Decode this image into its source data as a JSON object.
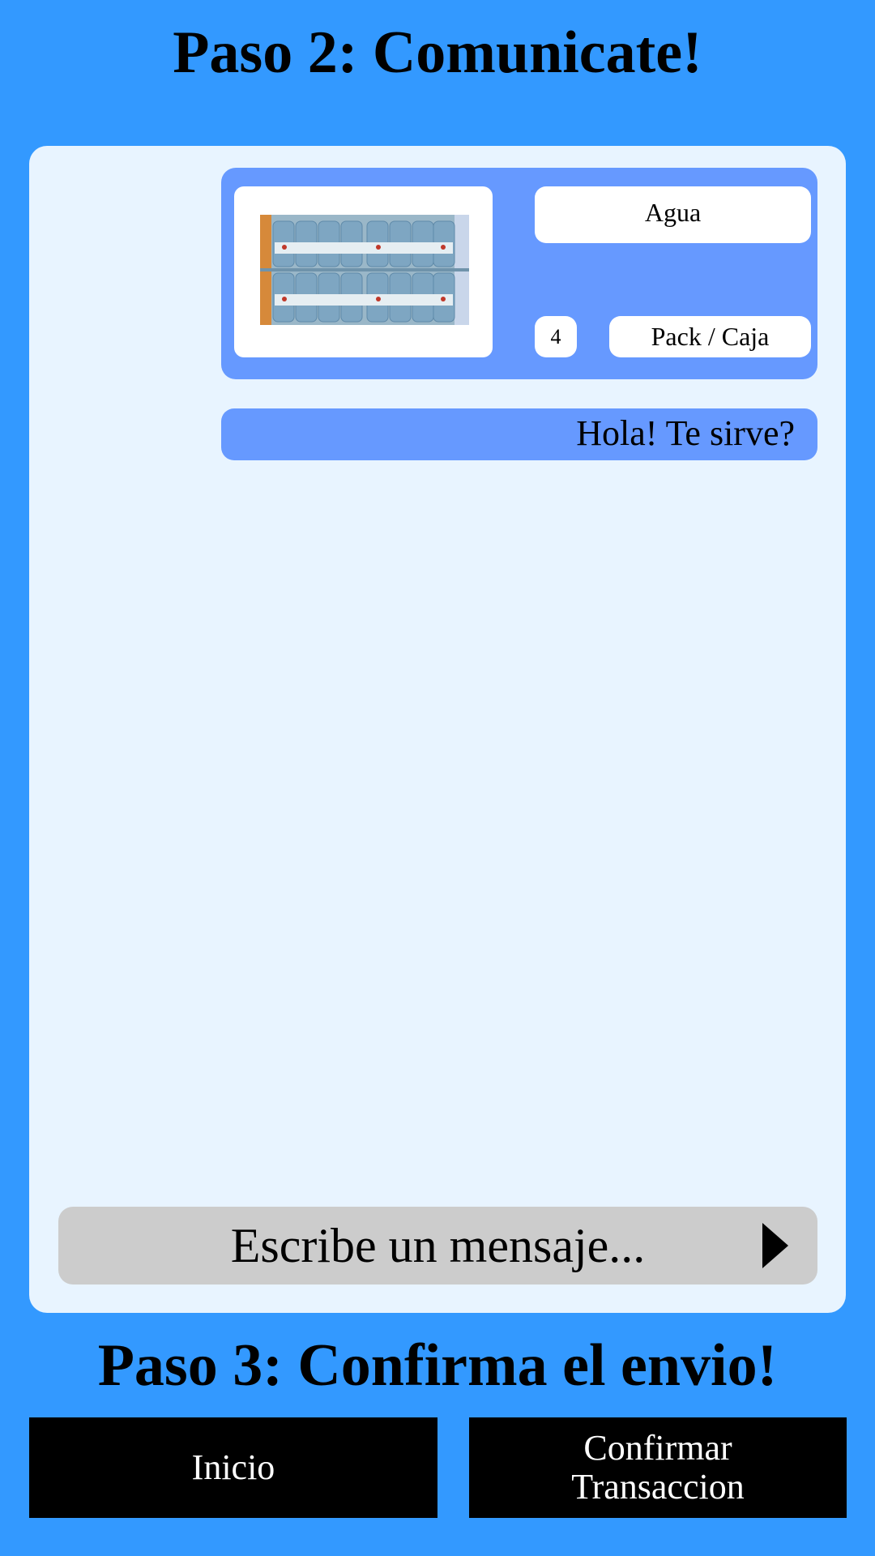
{
  "step2": {
    "title": "Paso 2: Comunicate!"
  },
  "product": {
    "name": "Agua",
    "quantity": "4",
    "unit": "Pack / Caja",
    "image_icon": "water-bottles-pack-photo"
  },
  "chat": {
    "messages": [
      {
        "text": "Hola! Te sirve?"
      }
    ]
  },
  "composer": {
    "placeholder": "Escribe un mensaje...",
    "value": "",
    "send_icon": "play-triangle-icon"
  },
  "step3": {
    "title": "Paso 3: Confirma el envio!"
  },
  "buttons": {
    "home_label": "Inicio",
    "confirm_label": "Confirmar Transaccion"
  },
  "colors": {
    "background": "#3399ff",
    "panel": "#e8f4ff",
    "card": "#6699ff",
    "composer": "#cccccc",
    "button": "#000000"
  }
}
